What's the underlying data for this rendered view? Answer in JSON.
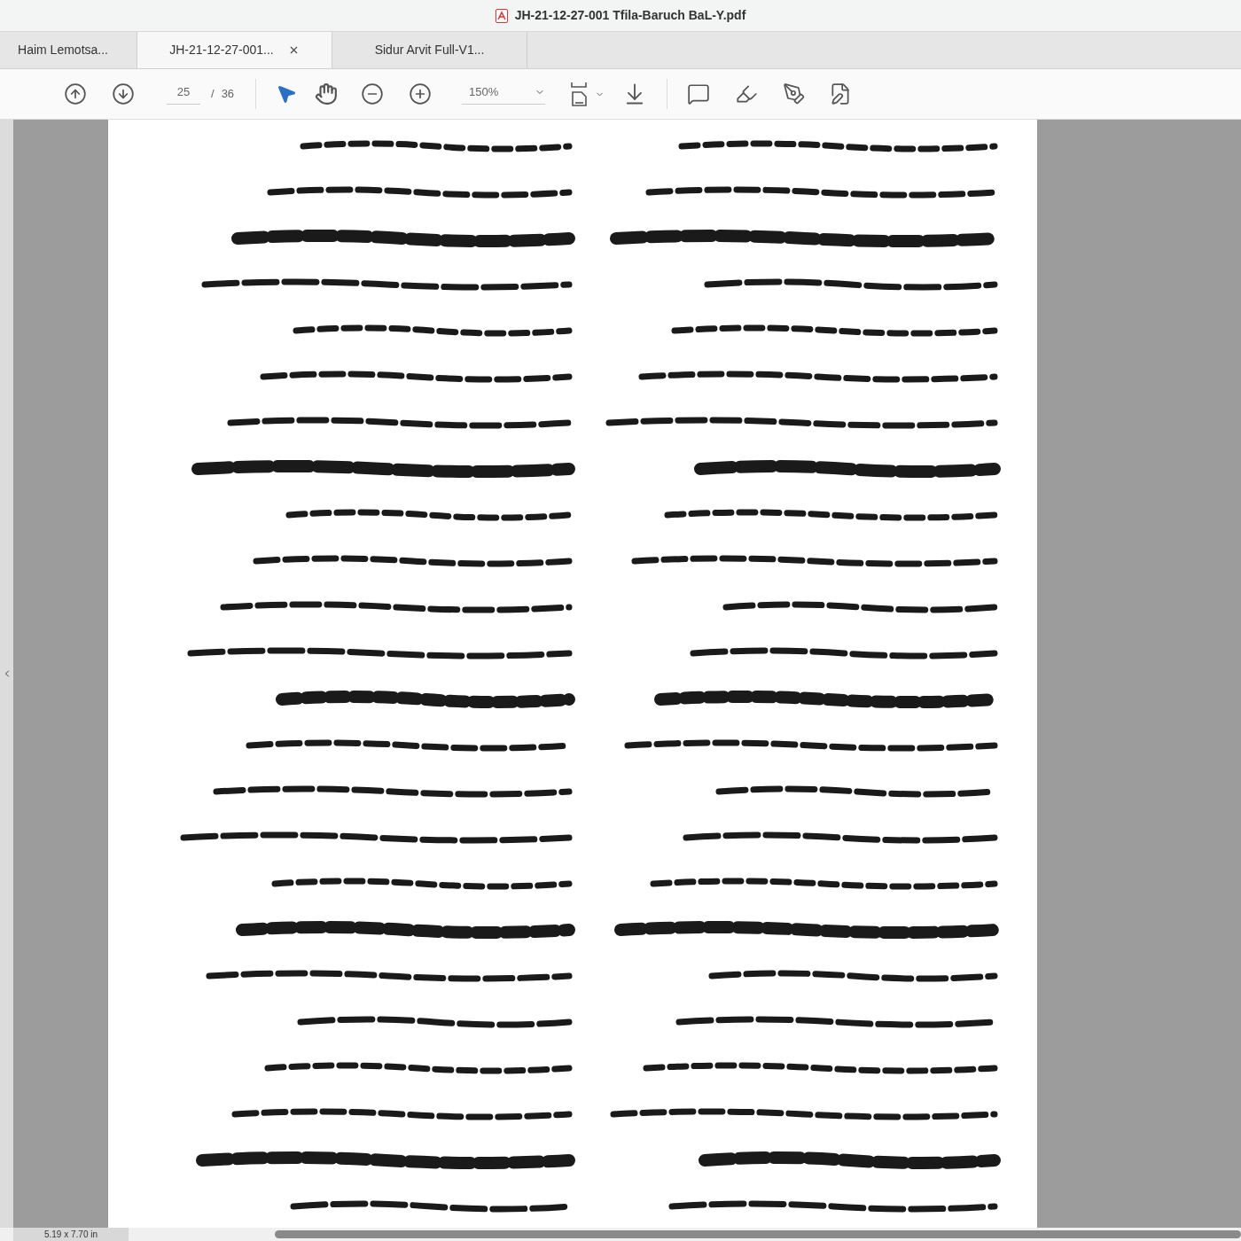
{
  "window": {
    "title": "JH-21-12-27-001 Tfila-Baruch BaL-Y.pdf"
  },
  "tabs": [
    {
      "label": "Haim Lemotsa...",
      "selected": false
    },
    {
      "label": "JH-21-12-27-001...",
      "selected": true
    },
    {
      "label": "Sidur Arvit Full-V1...",
      "selected": false
    }
  ],
  "toolbar": {
    "page_current": "25",
    "page_separator": "/",
    "page_total": "36",
    "zoom": "150%",
    "tools": [
      {
        "kind": "pointer",
        "selected": true
      },
      {
        "kind": "hand",
        "selected": false
      }
    ]
  },
  "status_bar": {
    "page_size": "5.19 x 7.70 in"
  }
}
